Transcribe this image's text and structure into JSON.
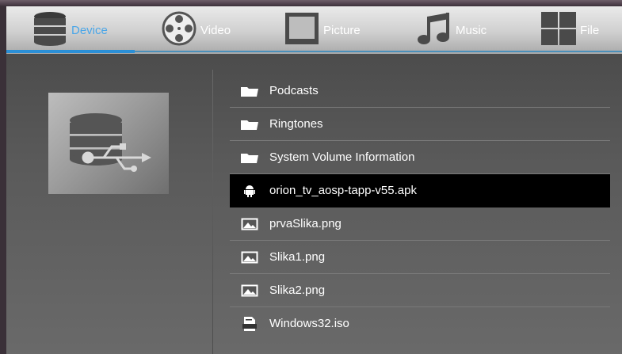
{
  "tabs": [
    {
      "id": "device",
      "label": "Device",
      "icon": "database-icon",
      "active": true
    },
    {
      "id": "video",
      "label": "Video",
      "icon": "film-reel-icon",
      "active": false
    },
    {
      "id": "picture",
      "label": "Picture",
      "icon": "picture-frame-icon",
      "active": false
    },
    {
      "id": "music",
      "label": "Music",
      "icon": "music-note-icon",
      "active": false
    },
    {
      "id": "file",
      "label": "File",
      "icon": "grid-icon",
      "active": false
    }
  ],
  "colors": {
    "accent": "#2b8fd6",
    "active_label": "#4aa6e8",
    "selected_row": "#000000"
  },
  "device_panel": {
    "icon": "usb-database-icon"
  },
  "files": [
    {
      "name": "Podcasts",
      "icon": "folder-icon"
    },
    {
      "name": "Ringtones",
      "icon": "folder-icon"
    },
    {
      "name": "System Volume Information",
      "icon": "folder-icon"
    },
    {
      "name": "orion_tv_aosp-tapp-v55.apk",
      "icon": "android-icon",
      "selected": true
    },
    {
      "name": "prvaSlika.png",
      "icon": "image-icon"
    },
    {
      "name": "Slika1.png",
      "icon": "image-icon"
    },
    {
      "name": "Slika2.png",
      "icon": "image-icon"
    },
    {
      "name": "Windows32.iso",
      "icon": "txt-file-icon"
    }
  ]
}
